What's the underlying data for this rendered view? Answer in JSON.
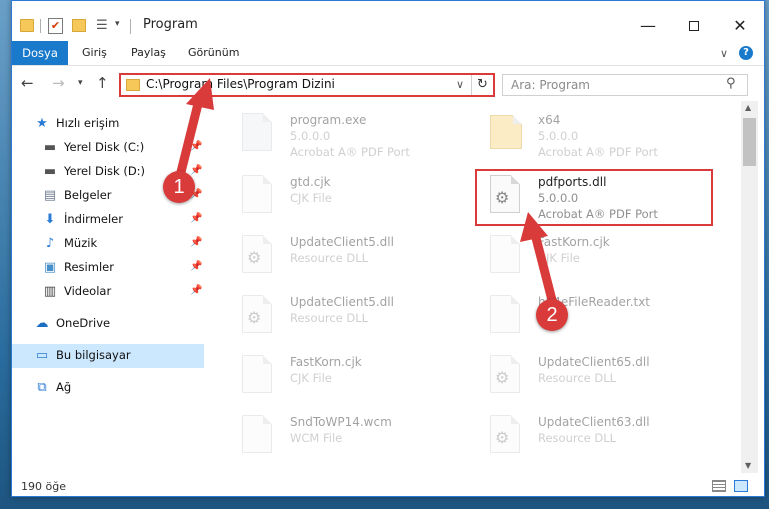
{
  "window": {
    "title": "Program",
    "quick_access": {
      "props_glyph": "☰",
      "drop_glyph": "▾",
      "check_glyph": "✔"
    }
  },
  "ribbon": {
    "tabs": [
      "Dosya",
      "Giriş",
      "Paylaş",
      "Görünüm"
    ],
    "help": "?"
  },
  "nav": {
    "address": "C:\\Program Files\\Program Dizini",
    "search_placeholder": "Ara: Program"
  },
  "sidebar": {
    "items": [
      {
        "label": "Hızlı erişim",
        "icon": "star-icon",
        "glyph": "★",
        "color": "#2b7bd6"
      },
      {
        "label": "Yerel Disk (C:)",
        "icon": "drive-icon",
        "glyph": "▬",
        "color": "#555555",
        "pinned": true
      },
      {
        "label": "Yerel Disk (D:)",
        "icon": "drive-icon",
        "glyph": "▬",
        "color": "#555555",
        "pinned": true
      },
      {
        "label": "Belgeler",
        "icon": "documents-icon",
        "glyph": "▤",
        "color": "#6c7c90",
        "pinned": true
      },
      {
        "label": "İndirmeler",
        "icon": "download-icon",
        "glyph": "⬇",
        "color": "#2b7bd6",
        "pinned": true
      },
      {
        "label": "Müzik",
        "icon": "music-icon",
        "glyph": "♪",
        "color": "#2b7bd6",
        "pinned": true
      },
      {
        "label": "Resimler",
        "icon": "pictures-icon",
        "glyph": "▣",
        "color": "#4a90c8",
        "pinned": true
      },
      {
        "label": "Videolar",
        "icon": "video-icon",
        "glyph": "▥",
        "color": "#444444",
        "pinned": true
      },
      {
        "label": "OneDrive",
        "icon": "cloud-icon",
        "glyph": "☁",
        "color": "#1b6ec2"
      },
      {
        "label": "Bu bilgisayar",
        "icon": "computer-icon",
        "glyph": "▭",
        "color": "#2b7bd6",
        "selected": true
      },
      {
        "label": "Ağ",
        "icon": "network-icon",
        "glyph": "⧉",
        "color": "#2b7bd6"
      }
    ],
    "pin_glyph": "📌"
  },
  "files": [
    {
      "name": "program.exe",
      "line2": "5.0.0.0",
      "line3": "Acrobat A® PDF Port",
      "kind": "exe",
      "faded": true
    },
    {
      "name": "x64",
      "line2": "5.0.0.0",
      "line3": "Acrobat A® PDF Port",
      "kind": "folder",
      "faded": true
    },
    {
      "name": "gtd.cjk",
      "line2": "CJK File",
      "line3": "",
      "kind": "file",
      "faded": true
    },
    {
      "name": "pdfports.dll",
      "line2": "5.0.0.0",
      "line3": "Acrobat A® PDF Port",
      "kind": "dll",
      "faded": false
    },
    {
      "name": "UpdateClient5.dll",
      "line2": "Resource DLL",
      "line3": "",
      "kind": "dll",
      "faded": true
    },
    {
      "name": "FastKorn.cjk",
      "line2": "CJK File",
      "line3": "",
      "kind": "file",
      "faded": true
    },
    {
      "name": "UpdateClient5.dll",
      "line2": "Resource DLL",
      "line3": "",
      "kind": "dll",
      "faded": true
    },
    {
      "name": "hb4eFileReader.txt",
      "line2": "Text",
      "line3": "",
      "kind": "file",
      "faded": true
    },
    {
      "name": "FastKorn.cjk",
      "line2": "CJK File",
      "line3": "",
      "kind": "file",
      "faded": true
    },
    {
      "name": "UpdateClient65.dll",
      "line2": "Resource DLL",
      "line3": "",
      "kind": "dll",
      "faded": true
    },
    {
      "name": "SndToWP14.wcm",
      "line2": "WCM File",
      "line3": "",
      "kind": "file",
      "faded": true
    },
    {
      "name": "UpdateClient63.dll",
      "line2": "Resource DLL",
      "line3": "",
      "kind": "dll",
      "faded": true
    }
  ],
  "status": {
    "count": "190 öğe"
  },
  "annotations": {
    "badge1": "1",
    "badge2": "2",
    "accent": "#d93a3a"
  }
}
